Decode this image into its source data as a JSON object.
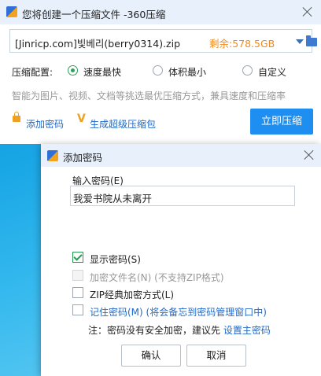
{
  "main_window": {
    "title": "您将创建一个压缩文件 -360压缩",
    "path": {
      "value": "[Jinricp.com]빛베리(berry0314).zip",
      "free_space": "剩余:578.5GB"
    },
    "compression": {
      "label": "压缩配置:",
      "options": [
        {
          "label": "速度最快",
          "selected": true
        },
        {
          "label": "体积最小",
          "selected": false
        },
        {
          "label": "自定义",
          "selected": false
        }
      ],
      "hint": "智能为图片、视频、文档等挑选最优压缩方式，兼具速度和压缩率"
    },
    "add_password_link": "添加密码",
    "super_package_link": "生成超级压缩包",
    "compress_button": "立即压缩"
  },
  "dialog": {
    "title": "添加密码",
    "input_label": "输入密码(E)",
    "password_value": "我爱书院从未离开",
    "checkboxes": [
      {
        "label": "显示密码(S)",
        "checked": true,
        "enabled": true
      },
      {
        "label": "加密文件名(N) (不支持ZIP格式)",
        "checked": false,
        "enabled": false
      },
      {
        "label": "ZIP经典加密方式(L)",
        "checked": false,
        "enabled": true
      },
      {
        "label": "记住密码(M) (将会备忘到密码管理窗口中)",
        "checked": false,
        "enabled": true
      }
    ],
    "note_prefix": "注：密码没有安全加密，建议先 ",
    "note_link": "设置主密码",
    "ok_button": "确认",
    "cancel_button": "取消"
  },
  "colors": {
    "accent": "#1e8ff0",
    "check_green": "#2a9b54",
    "orange": "#f08a1b",
    "link": "#1f69c8"
  }
}
